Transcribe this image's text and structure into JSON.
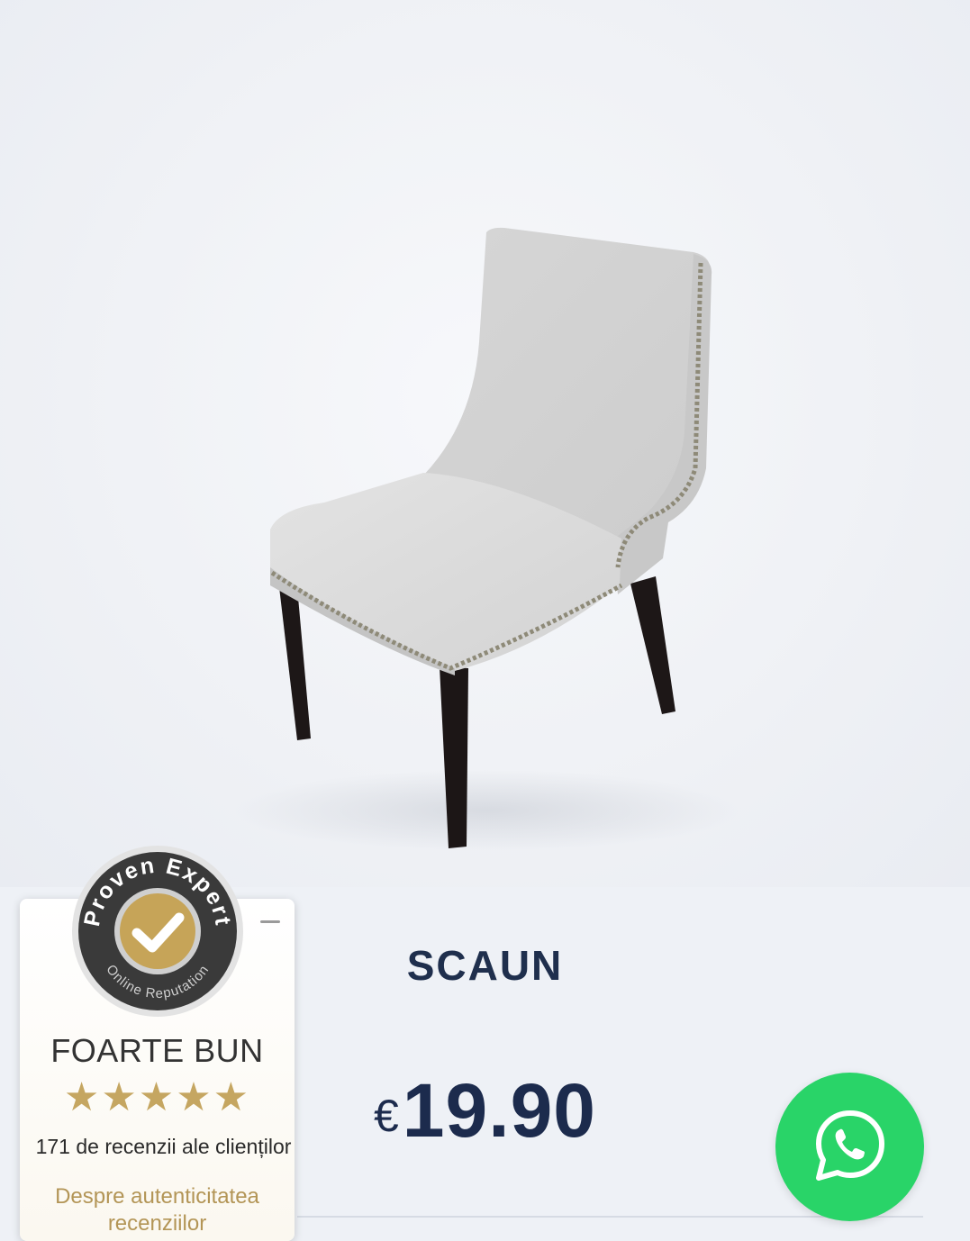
{
  "product": {
    "image_alt": "Grey upholstered dining chair with studded trim and dark wooden legs",
    "title": "SCAUN",
    "currency": "€",
    "price": "19.90"
  },
  "proven_expert": {
    "seal_top_text": "Proven Expert",
    "seal_bottom_text": "Online Reputation",
    "rating_label": "FOARTE BUN",
    "stars": 5,
    "stars_text": "★★★★★",
    "review_count_text": "171 de recenzii ale clienților",
    "authenticity_link": "Despre autenticitatea recenziilor",
    "accent_color": "#c5a661"
  },
  "whatsapp": {
    "icon": "whatsapp-icon",
    "color": "#29d468"
  }
}
